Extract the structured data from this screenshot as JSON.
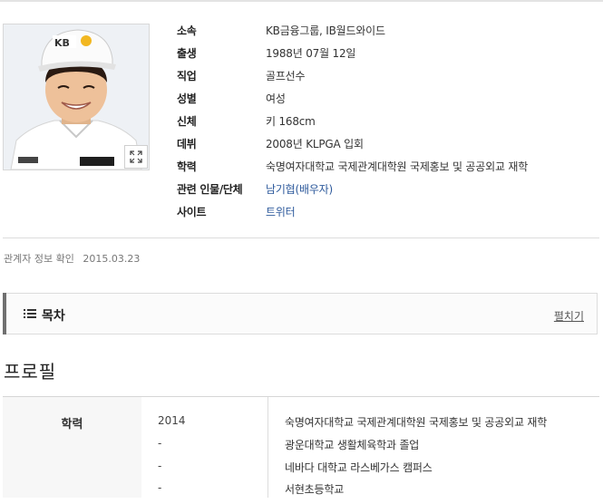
{
  "profile_info": {
    "rows": [
      {
        "label": "소속",
        "value": "KB금융그룹, IB월드와이드"
      },
      {
        "label": "출생",
        "value": "1988년 07월 12일"
      },
      {
        "label": "직업",
        "value": "골프선수"
      },
      {
        "label": "성별",
        "value": "여성"
      },
      {
        "label": "신체",
        "value": "키 168cm"
      },
      {
        "label": "데뷔",
        "value": "2008년 KLPGA 입회"
      },
      {
        "label": "학력",
        "value": "숙명여자대학교 국제관계대학원 국제홍보 및 공공외교 재학"
      },
      {
        "label": "관련 인물/단체",
        "value": "남기협(배우자)"
      },
      {
        "label": "사이트",
        "value": "트위터"
      }
    ],
    "photo_cap_text": "KB"
  },
  "confirmation": {
    "label": "관계자 정보 확인",
    "date": "2015.03.23"
  },
  "toc": {
    "title": "목차",
    "toggle_label": "펼치기"
  },
  "section": {
    "title": "프로필"
  },
  "profile_table": {
    "header": "학력",
    "rows": [
      {
        "year": "2014",
        "school": "숙명여자대학교 국제관계대학원 국제홍보 및 공공외교 재학"
      },
      {
        "year": "-",
        "school": "광운대학교 생활체육학과 졸업"
      },
      {
        "year": "-",
        "school": "네바다 대학교 라스베가스 캠퍼스"
      },
      {
        "year": "-",
        "school": "서현초등학교"
      }
    ]
  },
  "colors": {
    "link": "#2e5a9c",
    "toc_bar": "#707070",
    "table_header_bg": "#f7f7f7"
  },
  "icons": {
    "expand": "expand-icon",
    "toc": "list-icon"
  }
}
